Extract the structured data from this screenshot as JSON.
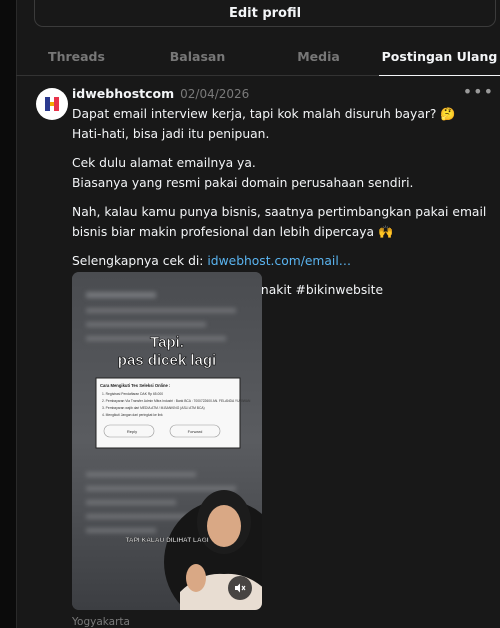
{
  "profile": {
    "edit_label": "Edit profil"
  },
  "tabs": [
    {
      "label": "Threads"
    },
    {
      "label": "Balasan"
    },
    {
      "label": "Media"
    },
    {
      "label": "Postingan Ulang"
    }
  ],
  "post": {
    "username": "idwebhostcom",
    "date": "02/04/2026",
    "more_icon": "more-horizontal-icon",
    "paragraphs": [
      {
        "line1": "Dapat email interview kerja, tapi kok malah disuruh bayar? 🤔",
        "line2": "Hati-hati, bisa jadi itu penipuan."
      },
      {
        "line1": "Cek dulu alamat emailnya ya.",
        "line2": "Biasanya yang resmi pakai domain perusahaan sendiri."
      },
      {
        "line1": "Nah, kalau kamu punya bisnis, saatnya pertimbangkan pakai email bisnis biar makin profesional dan lebih dipercaya 🙌"
      }
    ],
    "link_prefix": "Selengkapnya cek di: ",
    "link_text": "idwebhost.com/email…",
    "hashtags": "#idwebhost #emailhosting #anakit #bikinwebsite",
    "media": {
      "caption_top": "Tapi.",
      "caption_top2": "pas dicek lagi",
      "card_title": "Cara Mengikuti Tes Seleksi Online :",
      "card_items": [
        "1.  Registrasi Pendaftaran DAK Rp 65.000",
        "2.  Pembayaran Via Transfer Admin Mitra Industri : Bank BCA : 7000722600 AN. FELANDA YURIWAN",
        "3.  Pembayaran wajib dari MEDIA ATM / M-BANKING (ASLI ATM BCA)",
        "4.  Mengikuti Jangan dari peringkat ke link"
      ],
      "reply_label": "Reply",
      "forward_label": "Forward",
      "caption_bottom": "TAPI KALAU DILIHAT LAGI",
      "mute_icon": "speaker-muted-icon"
    },
    "location": "Yogyakarta"
  }
}
